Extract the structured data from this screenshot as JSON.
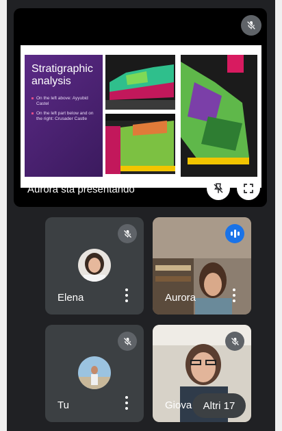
{
  "presentation": {
    "presenter_label": "Aurora sta presentando",
    "slide": {
      "title": "Stratigraphic analysis",
      "bullets": [
        "On the left above: Ayyubid Castel",
        "On the left part below and on the right: Crusader Castle"
      ]
    }
  },
  "participants": [
    {
      "name": "Elena",
      "muted": true
    },
    {
      "name": "Aurora",
      "speaking": true
    },
    {
      "name": "Tu",
      "muted": true
    },
    {
      "name": "Giova",
      "muted": true
    }
  ],
  "others_label": "Altri 17",
  "colors": {
    "background": "#202124",
    "tile": "#3c4043",
    "accent": "#1a73e8"
  }
}
